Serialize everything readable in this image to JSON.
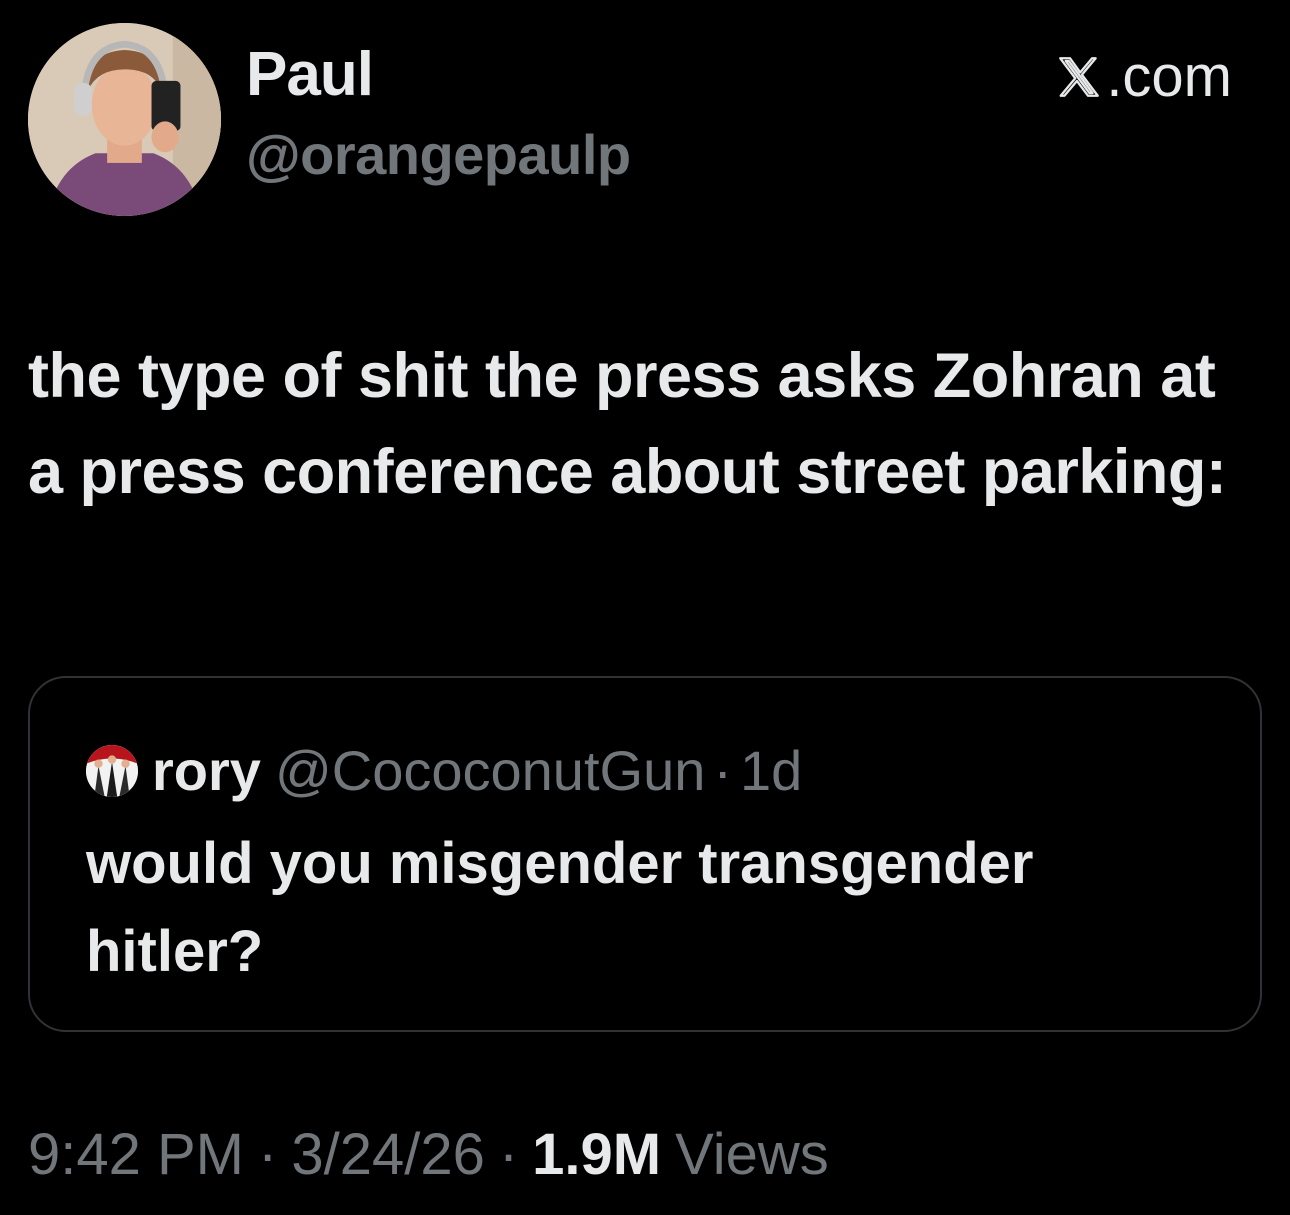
{
  "author": {
    "display_name": "Paul",
    "handle": "@orangepaulp",
    "avatar_icon": "profile-photo"
  },
  "source": {
    "label": ".com",
    "icon": "x-logo-icon"
  },
  "tweet": {
    "text": "the type of shit the press asks Zohran at a press conference about street parking:"
  },
  "quoted_tweet": {
    "display_name": "rory",
    "handle": "@CococonutGun",
    "dot": "·",
    "time": "1d",
    "text": "would you misgender transgender hitler?",
    "avatar_icon": "profile-photo"
  },
  "meta": {
    "time": "9:42 PM",
    "separator": "·",
    "date": "3/24/26",
    "views_count": "1.9M",
    "views_label": "Views"
  },
  "colors": {
    "background": "#000000",
    "primary_text": "#e7e9ea",
    "secondary_text": "#71767b",
    "border": "#2f3336"
  }
}
